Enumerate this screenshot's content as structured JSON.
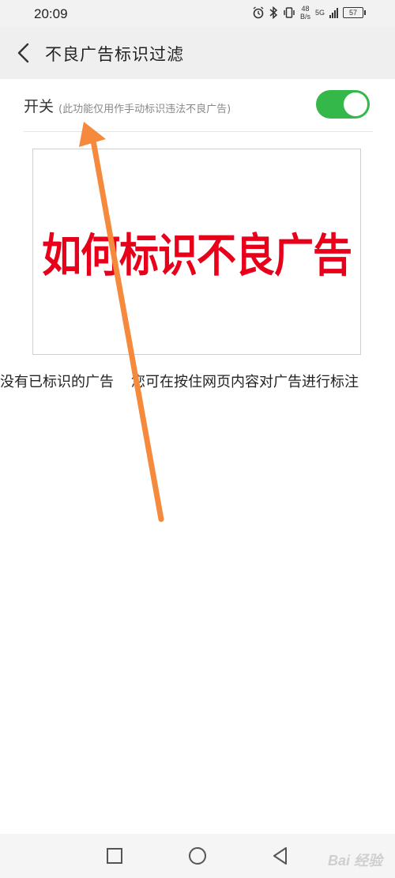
{
  "status": {
    "time": "20:09",
    "net_speed_value": "48",
    "net_speed_unit": "B/s",
    "network": "5G",
    "battery": "57"
  },
  "header": {
    "title": "不良广告标识过滤"
  },
  "setting": {
    "label": "开关",
    "description": "(此功能仅用作手动标识违法不良广告)",
    "enabled": true
  },
  "banner": {
    "text": "如何标识不良广告"
  },
  "empty_state": {
    "line1": "没有已标识的广告",
    "line2": "您可在按住网页内容对广告进行标注"
  },
  "watermark": "Bai 经验",
  "colors": {
    "toggle_on": "#35b84a",
    "banner_text": "#e8001b",
    "arrow": "#f58a3d"
  },
  "icons": [
    "back-icon",
    "alarm-icon",
    "bluetooth-icon",
    "vibrate-icon",
    "signal-icon",
    "battery-icon",
    "square-nav-icon",
    "circle-nav-icon",
    "triangle-nav-icon"
  ]
}
